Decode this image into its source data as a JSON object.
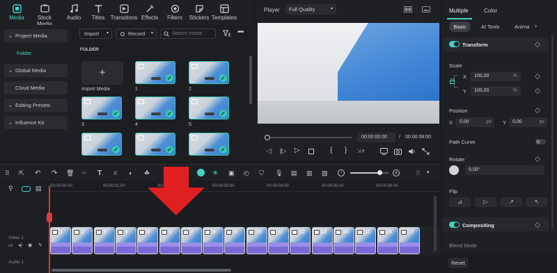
{
  "toolbar": {
    "items": [
      {
        "label": "Media",
        "icon": "media-icon",
        "active": true
      },
      {
        "label": "Stock Media",
        "icon": "stock-media-icon"
      },
      {
        "label": "Audio",
        "icon": "audio-note-icon"
      },
      {
        "label": "Titles",
        "icon": "titles-t-icon"
      },
      {
        "label": "Transitions",
        "icon": "transitions-icon"
      },
      {
        "label": "Effects",
        "icon": "effects-icon"
      },
      {
        "label": "Filters",
        "icon": "filters-icon"
      },
      {
        "label": "Stickers",
        "icon": "stickers-icon"
      },
      {
        "label": "Templates",
        "icon": "templates-icon"
      }
    ]
  },
  "sidebar": {
    "items": [
      {
        "label": "Project Media",
        "caret": "▸"
      },
      {
        "label": "Folder",
        "active": true
      },
      {
        "label": "Global Media",
        "caret": "▸"
      },
      {
        "label": "Cloud Media"
      },
      {
        "label": "Editing Presets",
        "caret": "▸"
      },
      {
        "label": "Influence Kit",
        "caret": "▸"
      }
    ]
  },
  "media": {
    "import_label": "Import",
    "record_label": "Record",
    "search_placeholder": "Search media",
    "folder_label": "FOLDER",
    "import_media_label": "Import Media",
    "thumb_labels": [
      "1",
      "2",
      "3",
      "4",
      "5"
    ]
  },
  "player": {
    "label": "Player",
    "quality": "Full Quality",
    "current_time": "00:00:00:00",
    "separator": "/",
    "total_time": "00:00:08:00"
  },
  "ruler": {
    "times": [
      "00:00:00:00",
      "00:00:01:00",
      "00:00:02:00",
      "00:00:03:00",
      "00:00:04:00",
      "00:00:05:00",
      "00:00:06:00"
    ]
  },
  "tracks": {
    "video_label": "Video 1",
    "audio_label": "Audio 1",
    "clip_numbers": [
      "1",
      "2",
      "3",
      "4",
      "5",
      "6",
      "7",
      "8",
      "9",
      "10",
      "11",
      "12",
      "13",
      "14",
      "15",
      "16",
      "17"
    ]
  },
  "inspector": {
    "tabs": [
      "Multiple",
      "Color"
    ],
    "subtabs": [
      "Basic",
      "AI Tools",
      "Anima"
    ],
    "transform_label": "Transform",
    "scale_label": "Scale",
    "scale_x_axis": "X",
    "scale_x": "100,00",
    "scale_y_axis": "Y",
    "scale_y": "100,00",
    "percent": "%",
    "position_label": "Position",
    "pos_x_axis": "X",
    "pos_x": "0,00",
    "pos_y_axis": "Y",
    "pos_y": "0,00",
    "px": "px",
    "path_curve_label": "Path Curve",
    "rotate_label": "Rotate",
    "rotate_value": "0,00°",
    "flip_label": "Flip",
    "compositing_label": "Compositing",
    "blend_mode_label": "Blend Mode",
    "reset_label": "Reset"
  },
  "colors": {
    "accent": "#41d6c3",
    "arrow": "#e02020",
    "clip_purple": "#7b6ad6"
  }
}
